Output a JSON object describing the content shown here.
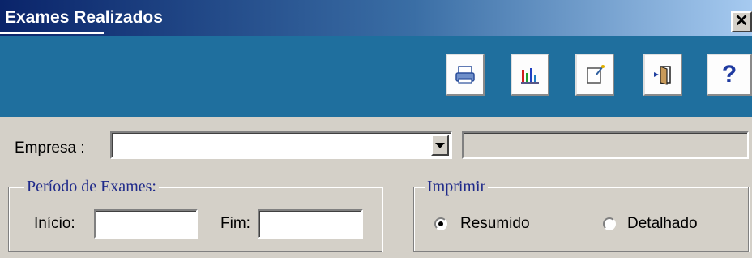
{
  "window": {
    "title": "Exames Realizados",
    "close_glyph": "✕"
  },
  "toolbar": {
    "buttons": [
      {
        "icon": "printer-icon",
        "name": "print-button"
      },
      {
        "icon": "bar-chart-icon",
        "name": "chart-button"
      },
      {
        "icon": "edit-note-icon",
        "name": "edit-button"
      },
      {
        "icon": "exit-door-icon",
        "name": "exit-button"
      },
      {
        "icon": "help-icon",
        "name": "help-button",
        "glyph": "?"
      }
    ],
    "background_color": "#1f6f9e"
  },
  "empresa": {
    "label": "Empresa :",
    "value": "",
    "secondary_value": ""
  },
  "periodo": {
    "legend": "Período de Exames:",
    "inicio_label": "Início:",
    "inicio_value": "",
    "fim_label": "Fim:",
    "fim_value": ""
  },
  "imprimir": {
    "legend": "Imprimir",
    "options": [
      {
        "label": "Resumido",
        "selected": true
      },
      {
        "label": "Detalhado",
        "selected": false
      }
    ]
  }
}
